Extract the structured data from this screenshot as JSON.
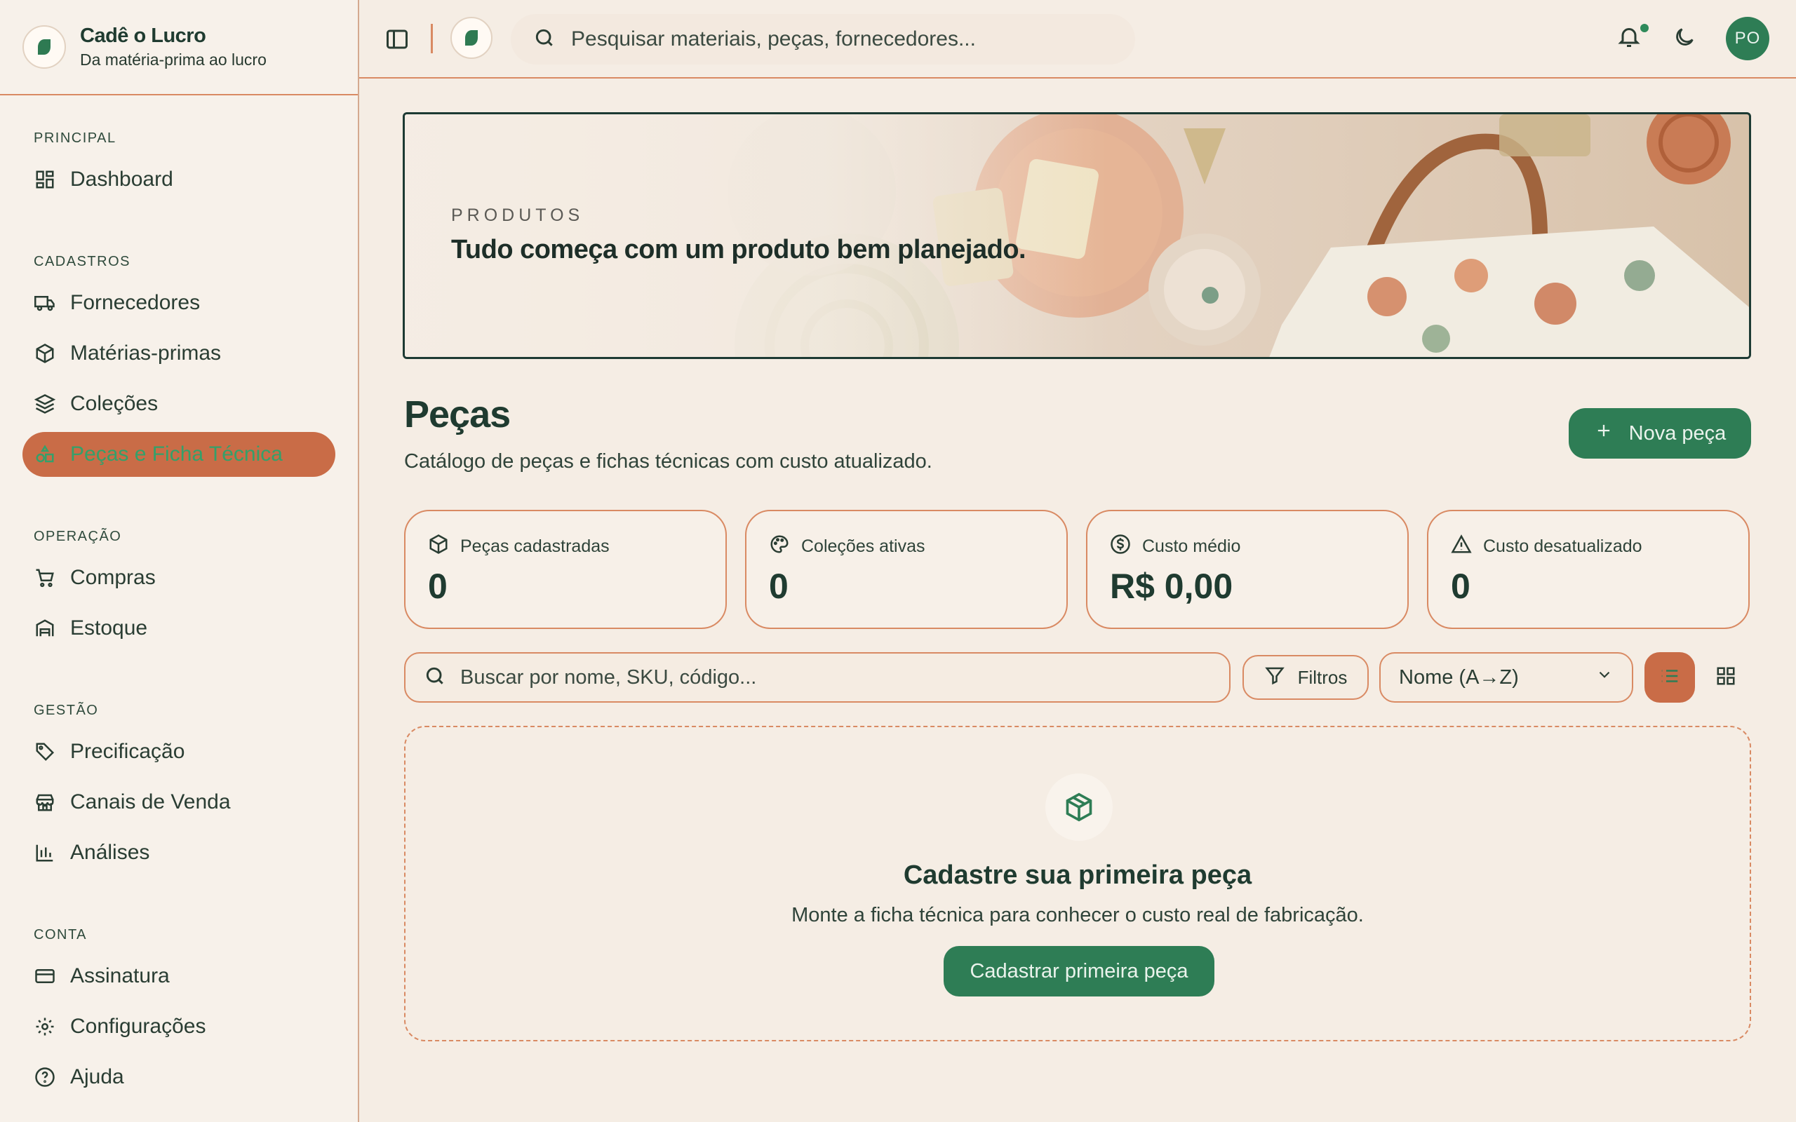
{
  "brand": {
    "title": "Cadê o Lucro",
    "subtitle": "Da matéria-prima ao lucro",
    "logo_text": "Cadê o Lucro"
  },
  "sidebar": {
    "sections": [
      {
        "heading": "PRINCIPAL",
        "items": [
          {
            "label": "Dashboard",
            "icon": "dashboard-icon"
          }
        ]
      },
      {
        "heading": "CADASTROS",
        "items": [
          {
            "label": "Fornecedores",
            "icon": "truck-icon"
          },
          {
            "label": "Matérias-primas",
            "icon": "box-icon"
          },
          {
            "label": "Coleções",
            "icon": "layers-icon"
          },
          {
            "label": "Peças e Ficha Técnica",
            "icon": "shapes-icon",
            "active": true
          }
        ]
      },
      {
        "heading": "OPERAÇÃO",
        "items": [
          {
            "label": "Compras",
            "icon": "cart-icon"
          },
          {
            "label": "Estoque",
            "icon": "warehouse-icon"
          }
        ]
      },
      {
        "heading": "GESTÃO",
        "items": [
          {
            "label": "Precificação",
            "icon": "tag-icon"
          },
          {
            "label": "Canais de Venda",
            "icon": "store-icon"
          },
          {
            "label": "Análises",
            "icon": "bar-chart-icon"
          }
        ]
      },
      {
        "heading": "CONTA",
        "items": [
          {
            "label": "Assinatura",
            "icon": "credit-card-icon"
          },
          {
            "label": "Configurações",
            "icon": "gear-icon"
          },
          {
            "label": "Ajuda",
            "icon": "help-icon"
          }
        ]
      }
    ]
  },
  "topbar": {
    "search_placeholder": "Pesquisar materiais, peças, fornecedores...",
    "avatar_initials": "PO"
  },
  "banner": {
    "eyebrow": "PRODUTOS",
    "title": "Tudo começa com um produto bem planejado."
  },
  "page": {
    "title": "Peças",
    "subtitle": "Catálogo de peças e fichas técnicas com custo atualizado.",
    "new_button": "Nova peça"
  },
  "stats": [
    {
      "label": "Peças cadastradas",
      "value": "0",
      "icon": "box-icon"
    },
    {
      "label": "Coleções ativas",
      "value": "0",
      "icon": "palette-icon"
    },
    {
      "label": "Custo médio",
      "value": "R$ 0,00",
      "icon": "dollar-icon"
    },
    {
      "label": "Custo desatualizado",
      "value": "0",
      "icon": "warning-icon"
    }
  ],
  "toolbar": {
    "search_placeholder": "Buscar por nome, SKU, código...",
    "filter_label": "Filtros",
    "sort_value": "Nome (A→Z)"
  },
  "empty_state": {
    "title": "Cadastre sua primeira peça",
    "subtitle": "Monte a ficha técnica para conhecer o custo real de fabricação.",
    "button": "Cadastrar primeira peça"
  },
  "colors": {
    "accent": "#c96c47",
    "primary": "#2e7d55",
    "background": "#f5ede4",
    "border": "#d98a63"
  }
}
